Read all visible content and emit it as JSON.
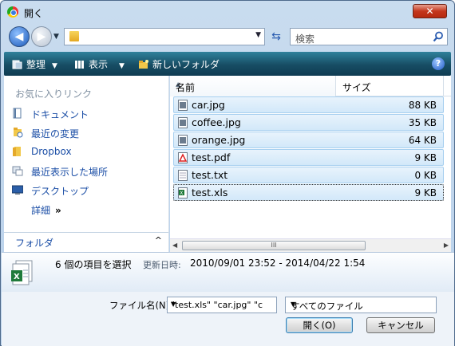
{
  "window": {
    "title": "開く",
    "close_label": "✕"
  },
  "address": {
    "path": "",
    "search_placeholder": "検索"
  },
  "toolbar": {
    "organize": "整理",
    "views": "表示",
    "new_folder": "新しいフォルダ",
    "help": "?"
  },
  "nav": {
    "favorites_header": "お気に入りリンク",
    "items": [
      {
        "label": "ドキュメント",
        "icon": "documents-icon"
      },
      {
        "label": "最近の変更",
        "icon": "recent-changes-icon"
      },
      {
        "label": "Dropbox",
        "icon": "folder-icon"
      },
      {
        "label": "最近表示した場所",
        "icon": "recent-places-icon"
      },
      {
        "label": "デスクトップ",
        "icon": "desktop-icon"
      }
    ],
    "more_label": "詳細",
    "more_chevron": "»",
    "folder_label": "フォルダ",
    "folder_chevron": "^"
  },
  "list": {
    "columns": {
      "name": "名前",
      "size": "サイズ"
    },
    "files": [
      {
        "name": "car.jpg",
        "size": "88 KB",
        "type": "image"
      },
      {
        "name": "coffee.jpg",
        "size": "35 KB",
        "type": "image"
      },
      {
        "name": "orange.jpg",
        "size": "64 KB",
        "type": "image"
      },
      {
        "name": "test.pdf",
        "size": "9 KB",
        "type": "pdf"
      },
      {
        "name": "test.txt",
        "size": "0 KB",
        "type": "text"
      },
      {
        "name": "test.xls",
        "size": "9 KB",
        "type": "excel"
      }
    ],
    "scroll_grip": "III"
  },
  "details": {
    "selection": "6 個の項目を選択",
    "modified_label": "更新日時:",
    "modified_value": "2010/09/01 23:52 - 2014/04/22 1:54"
  },
  "form": {
    "filename_label": "ファイル名(N):",
    "filename_value": "\"test.xls\" \"car.jpg\" \"c",
    "filetype_value": "すべてのファイル",
    "open_button": "開く(O)",
    "cancel_button": "キャンセル"
  },
  "colors": {
    "accent": "#1b4ea6",
    "toolbar": "#174d64",
    "selection": "#d2e8f9"
  }
}
